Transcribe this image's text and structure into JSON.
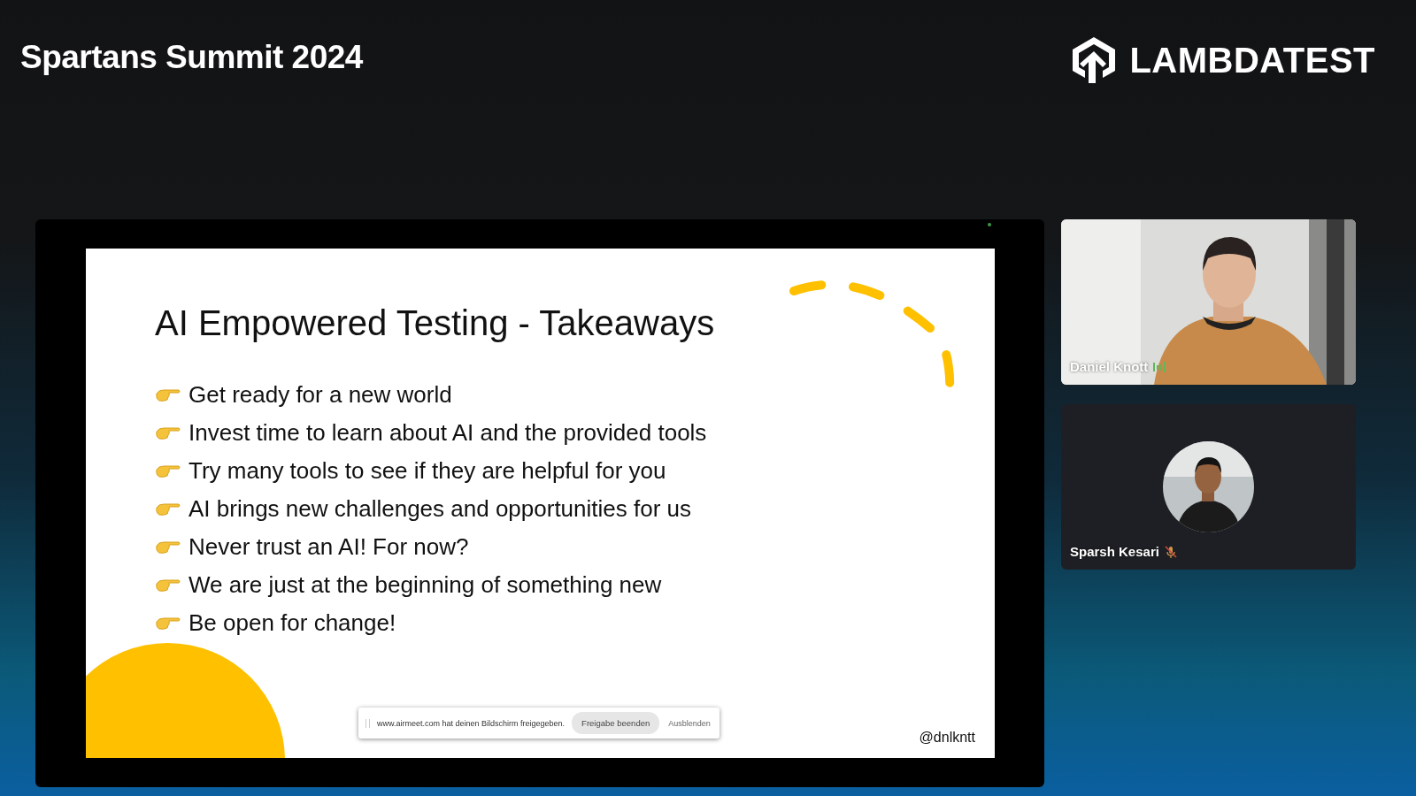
{
  "event_title": "Spartans Summit 2024",
  "logo": {
    "text": "LAMBDATEST"
  },
  "slide": {
    "title": "AI Empowered Testing - Takeaways",
    "bullets": [
      "Get ready for a new world",
      "Invest time to learn about AI and the provided tools",
      "Try many tools to see if they are helpful for you",
      "AI brings new challenges and opportunities for us",
      "Never trust an AI! For now?",
      "We are just at the beginning of something new",
      "Be open for change!"
    ],
    "handle": "@dnlkntt"
  },
  "share_bar": {
    "message": "www.airmeet.com hat deinen Bildschirm freigegeben.",
    "buttons": [
      {
        "label": "Freigabe beenden",
        "kind": "primary"
      },
      {
        "label": "Ausblenden",
        "kind": "link"
      }
    ]
  },
  "participants": [
    {
      "name": "Daniel Knott",
      "kind": "video",
      "speaking": true,
      "muted": false
    },
    {
      "name": "Sparsh Kesari",
      "kind": "avatar",
      "speaking": false,
      "muted": true
    }
  ]
}
